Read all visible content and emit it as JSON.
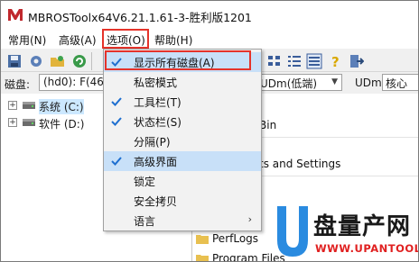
{
  "window": {
    "title": "MBROSToolx64V6.21.1.61-3-胜利版1201"
  },
  "menubar": {
    "items": [
      "常用(N)",
      "高级(A)",
      "选项(O)",
      "帮助(H)"
    ]
  },
  "toolbar": {
    "icons": [
      "save-icon",
      "settings-icon",
      "open-icon",
      "refresh-icon",
      "grid-icon",
      "list-icon",
      "details-icon",
      "help-icon",
      "exit-icon"
    ]
  },
  "diskbar": {
    "label": "磁盘:",
    "disk_value": "(hd0): F(46",
    "mode_value": "UDm(低端)",
    "udm_label": "UDm:",
    "udm_value": "核心"
  },
  "tree": {
    "items": [
      {
        "label": "系统 (C:)",
        "selected": true
      },
      {
        "label": "软件 (D:)",
        "selected": false
      }
    ]
  },
  "right_pane": {
    "rows": [
      "Bin",
      "ts and Settings",
      "PerfLogs",
      "Program Files"
    ]
  },
  "options_menu": {
    "items": [
      {
        "label": "显示所有磁盘(A)",
        "checked": true,
        "submenu": false,
        "highlighted": true
      },
      {
        "label": "私密模式",
        "checked": false,
        "submenu": false,
        "highlighted": false
      },
      {
        "label": "工具栏(T)",
        "checked": true,
        "submenu": false,
        "highlighted": false
      },
      {
        "label": "状态栏(S)",
        "checked": true,
        "submenu": false,
        "highlighted": false
      },
      {
        "label": "分隔(P)",
        "checked": false,
        "submenu": false,
        "highlighted": false
      },
      {
        "label": "高级界面",
        "checked": true,
        "submenu": false,
        "highlighted": false
      },
      {
        "label": "锁定",
        "checked": false,
        "submenu": false,
        "highlighted": false
      },
      {
        "label": "安全拷贝",
        "checked": false,
        "submenu": false,
        "highlighted": false
      },
      {
        "label": "语言",
        "checked": false,
        "submenu": true,
        "highlighted": false
      }
    ]
  },
  "watermark": {
    "brand": "盘量产网",
    "url": "WWW.UPANTOOL.COM"
  },
  "colors": {
    "highlight_border": "#e5332a",
    "check": "#1e6fd0",
    "hover": "#c8e0f8",
    "selection": "#cce8ff"
  }
}
